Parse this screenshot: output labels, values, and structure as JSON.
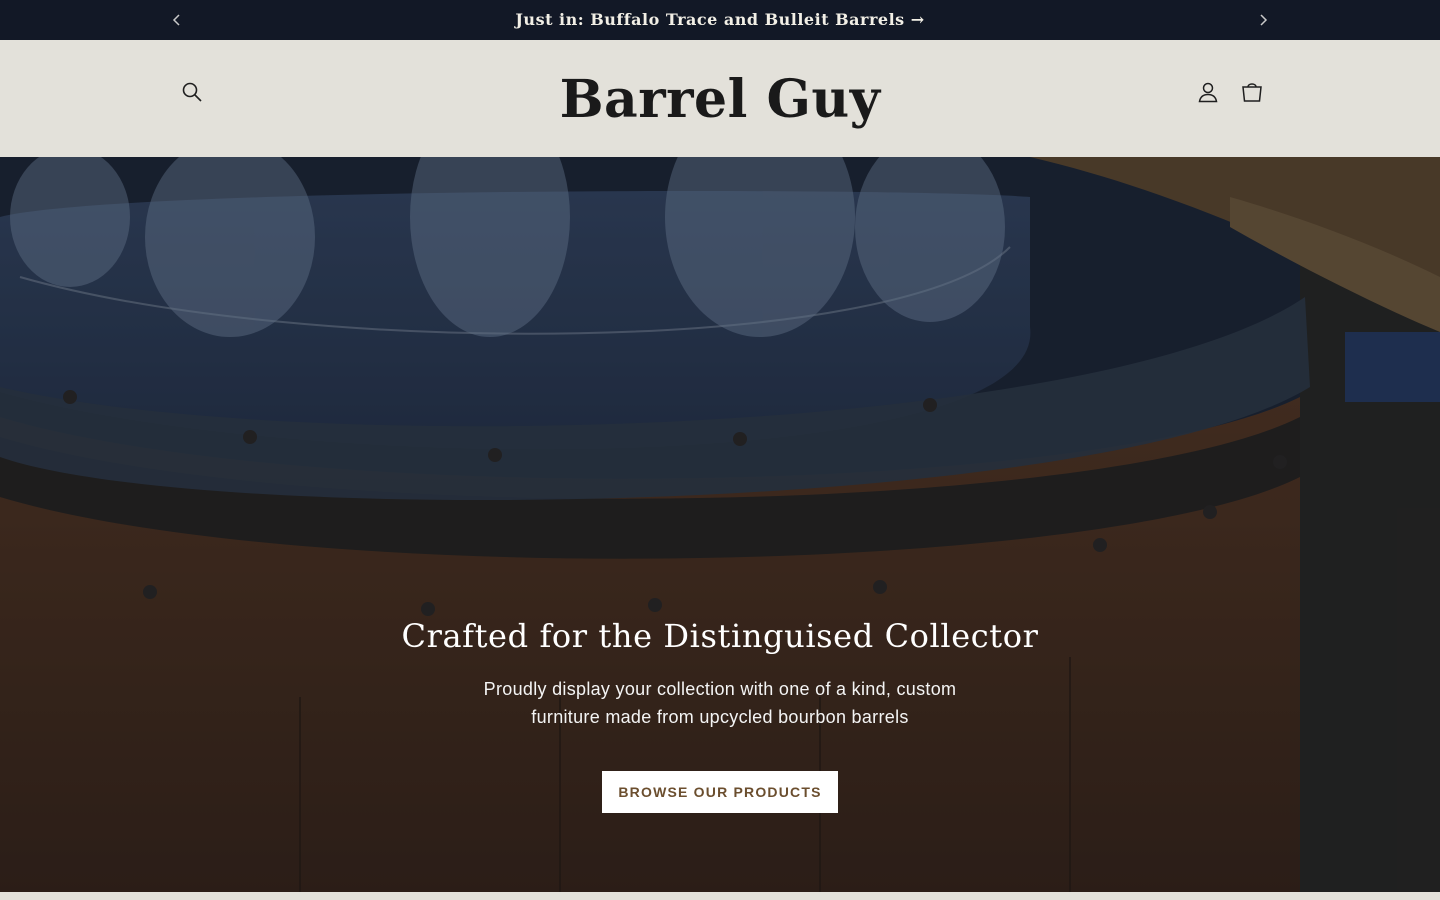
{
  "announcement": {
    "text": "Just in: Buffalo Trace and Bulleit Barrels →"
  },
  "header": {
    "logo": "Barrel Guy"
  },
  "hero": {
    "heading": "Crafted for the Distinguised Collector",
    "subheading": "Proudly display your collection with one of a kind, custom furniture made from upcycled bourbon barrels",
    "cta_label": "BROWSE OUR PRODUCTS"
  },
  "icons": [
    "chevron-left-icon",
    "chevron-right-icon",
    "search-icon",
    "account-icon",
    "cart-icon"
  ],
  "colors": {
    "announcement_bg": "#121826",
    "header_bg": "#e3e1da",
    "cta_text": "#6b4e2e"
  }
}
